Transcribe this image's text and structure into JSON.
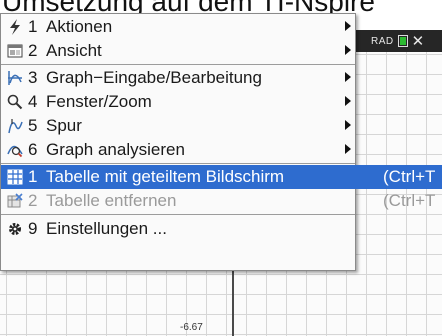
{
  "window": {
    "title": "Umsetzung auf dem TI-Nspire"
  },
  "status_bar": {
    "mode": "RAD",
    "battery_level": 0.7
  },
  "graph": {
    "y_axis_tick_label": "-6.67"
  },
  "menu": {
    "items": [
      {
        "number": "1",
        "label": "Aktionen",
        "icon": "lightning-icon",
        "has_submenu": true
      },
      {
        "number": "2",
        "label": "Ansicht",
        "icon": "view-icon",
        "has_submenu": true
      },
      {
        "number": "3",
        "label": "Graph−Eingabe/Bearbeitung",
        "icon": "graph-edit-icon",
        "has_submenu": true
      },
      {
        "number": "4",
        "label": "Fenster/Zoom",
        "icon": "magnifier-icon",
        "has_submenu": true
      },
      {
        "number": "5",
        "label": "Spur",
        "icon": "trace-icon",
        "has_submenu": true
      },
      {
        "number": "6",
        "label": "Graph analysieren",
        "icon": "analyze-graph-icon",
        "has_submenu": true
      },
      {
        "number": "1",
        "label": "Tabelle mit geteiltem Bildschirm",
        "shortcut": "(Ctrl+T",
        "icon": "table-icon",
        "selected": true
      },
      {
        "number": "2",
        "label": "Tabelle entfernen",
        "shortcut": "(Ctrl+T",
        "icon": "remove-table-icon",
        "disabled": true
      },
      {
        "number": "9",
        "label": "Einstellungen ...",
        "icon": "gear-icon"
      }
    ]
  }
}
